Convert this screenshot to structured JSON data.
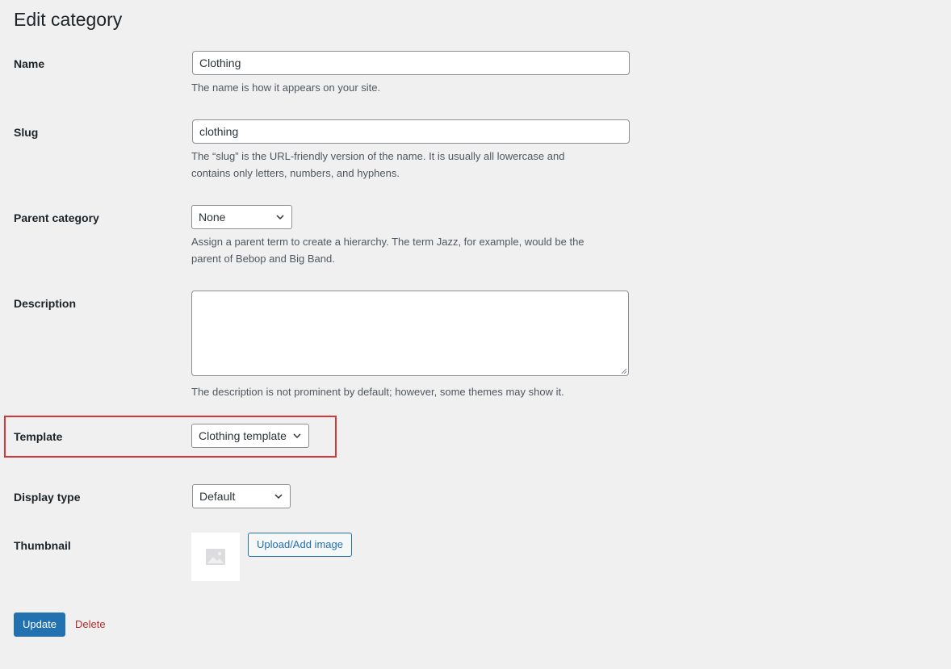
{
  "page": {
    "title": "Edit category"
  },
  "fields": {
    "name": {
      "label": "Name",
      "value": "Clothing",
      "help": "The name is how it appears on your site."
    },
    "slug": {
      "label": "Slug",
      "value": "clothing",
      "help": "The “slug” is the URL-friendly version of the name. It is usually all lowercase and contains only letters, numbers, and hyphens."
    },
    "parent": {
      "label": "Parent category",
      "selected": "None",
      "help": "Assign a parent term to create a hierarchy. The term Jazz, for example, would be the parent of Bebop and Big Band."
    },
    "description": {
      "label": "Description",
      "value": "",
      "help": "The description is not prominent by default; however, some themes may show it."
    },
    "template": {
      "label": "Template",
      "selected": "Clothing template"
    },
    "display_type": {
      "label": "Display type",
      "selected": "Default"
    },
    "thumbnail": {
      "label": "Thumbnail",
      "upload_label": "Upload/Add image",
      "placeholder_icon": "image-placeholder-icon"
    }
  },
  "actions": {
    "update_label": "Update",
    "delete_label": "Delete"
  },
  "colors": {
    "primary": "#2271b1",
    "danger": "#b32d2e",
    "highlight": "#d63638",
    "background": "#f0f0f1"
  }
}
